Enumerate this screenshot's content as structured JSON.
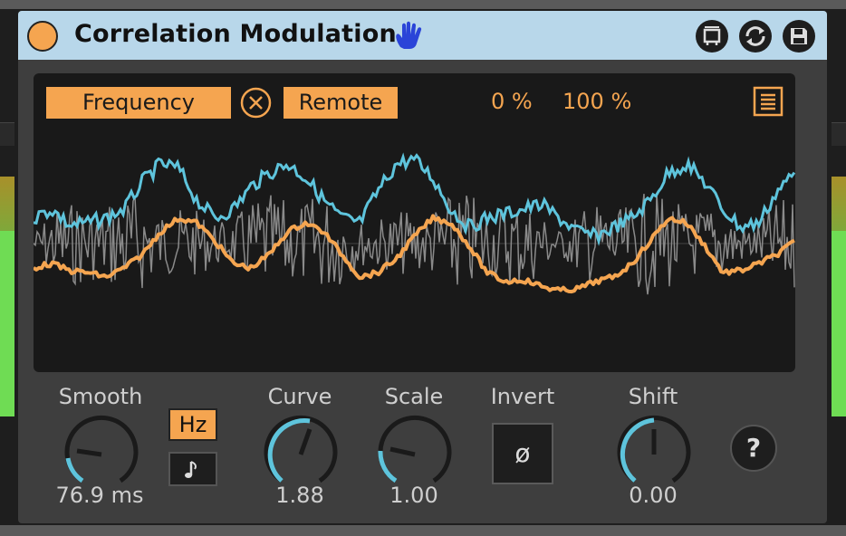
{
  "device": {
    "title": "Correlation Modulation",
    "icons": {
      "power": "power-toggle-icon",
      "hand": "hand-icon",
      "map": "map-icon",
      "refresh": "refresh-icon",
      "save": "save-icon"
    }
  },
  "display": {
    "param_label": "Frequency",
    "remote_label": "Remote",
    "min_pct": "0 %",
    "max_pct": "100 %",
    "colors": {
      "accent": "#f5a550",
      "blue_line": "#5ec4dc",
      "gray_wave": "#8a8a8a"
    }
  },
  "controls": {
    "smooth": {
      "label": "Smooth",
      "value": "76.9 ms"
    },
    "hz_label": "Hz",
    "note_label": "𝅘𝅥𝅮",
    "curve": {
      "label": "Curve",
      "value": "1.88"
    },
    "scale": {
      "label": "Scale",
      "value": "1.00"
    },
    "invert": {
      "label": "Invert",
      "button": "ø"
    },
    "shift": {
      "label": "Shift",
      "value": "0.00"
    },
    "help": "?"
  }
}
